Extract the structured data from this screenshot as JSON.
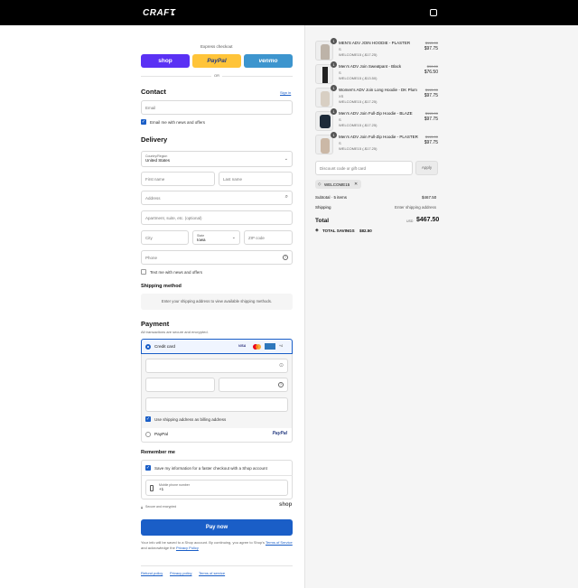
{
  "header": {
    "logo": "CRAFT"
  },
  "express": {
    "title": "Express checkout",
    "shop": "shop",
    "paypal": "PayPal",
    "venmo": "venmo",
    "or": "OR"
  },
  "contact": {
    "title": "Contact",
    "signin": "Sign in",
    "email_placeholder": "Email",
    "email_news": "Email me with news and offers"
  },
  "delivery": {
    "title": "Delivery",
    "country_label": "Country/Region",
    "country_value": "United States",
    "first_name": "First name",
    "last_name": "Last name",
    "address": "Address",
    "apartment": "Apartment, suite, etc. (optional)",
    "city": "City",
    "state_label": "State",
    "state_value": "Iowa",
    "zip": "ZIP code",
    "phone": "Phone",
    "text_news": "Text me with news and offers"
  },
  "shipping": {
    "title": "Shipping method",
    "message": "Enter your shipping address to view available shipping methods."
  },
  "payment": {
    "title": "Payment",
    "subtitle": "All transactions are secure and encrypted.",
    "credit_card": "Credit card",
    "card_logos": [
      "VISA",
      "MC",
      "AMEX",
      "+4"
    ],
    "billing": "Use shipping address as billing address",
    "paypal_option": "PayPal",
    "paypal_logo": "PayPal"
  },
  "remember": {
    "title": "Remember me",
    "save_info": "Save my information for a faster checkout with a Shop account",
    "phone_label": "Mobile phone number",
    "phone_value": "+1",
    "secure": "Secure and encrypted",
    "shop_logo": "shop"
  },
  "pay_now": "Pay now",
  "legal": {
    "text1": "Your info will be saved to a Shop account. By continuing, you agree to Shop's",
    "terms": "Terms of Service",
    "text2": "and acknowledge the",
    "privacy": "Privacy Policy"
  },
  "footer": {
    "refund": "Refund policy",
    "privacy": "Privacy policy",
    "terms": "Terms of service"
  },
  "items": [
    {
      "qty": "1",
      "name": "MEN'S ADV JOIN HOODIE - PLASTER",
      "size": "S",
      "code": "WELCOME15 (-$17.25)",
      "old": "$115.00",
      "new": "$97.75"
    },
    {
      "qty": "1",
      "name": "Men's ADV Join Sweatpant - Black",
      "size": "S",
      "code": "WELCOME15 (-$13.50)",
      "old": "$90.00",
      "new": "$76.50"
    },
    {
      "qty": "1",
      "name": "Women's ADV Join Long Hoodie - DK Plum",
      "size": "XS",
      "code": "WELCOME15 (-$17.25)",
      "old": "$115.00",
      "new": "$97.75"
    },
    {
      "qty": "1",
      "name": "Men's ADV Join Full-Zip Hoodie - BLAZE",
      "size": "S",
      "code": "WELCOME15 (-$17.25)",
      "old": "$115.00",
      "new": "$97.75"
    },
    {
      "qty": "1",
      "name": "Men's ADV Join Full-Zip Hoodie - PLASTER",
      "size": "S",
      "code": "WELCOME15 (-$17.25)",
      "old": "$115.00",
      "new": "$97.75"
    }
  ],
  "discount": {
    "placeholder": "Discount code or gift card",
    "apply": "Apply",
    "tag": "WELCOME15"
  },
  "summary": {
    "subtotal_label": "Subtotal · 5 items",
    "subtotal": "$467.50",
    "shipping_label": "Shipping",
    "shipping": "Enter shipping address",
    "total_label": "Total",
    "currency": "USD",
    "total": "$467.50",
    "savings_label": "TOTAL SAVINGS",
    "savings": "$82.50"
  }
}
